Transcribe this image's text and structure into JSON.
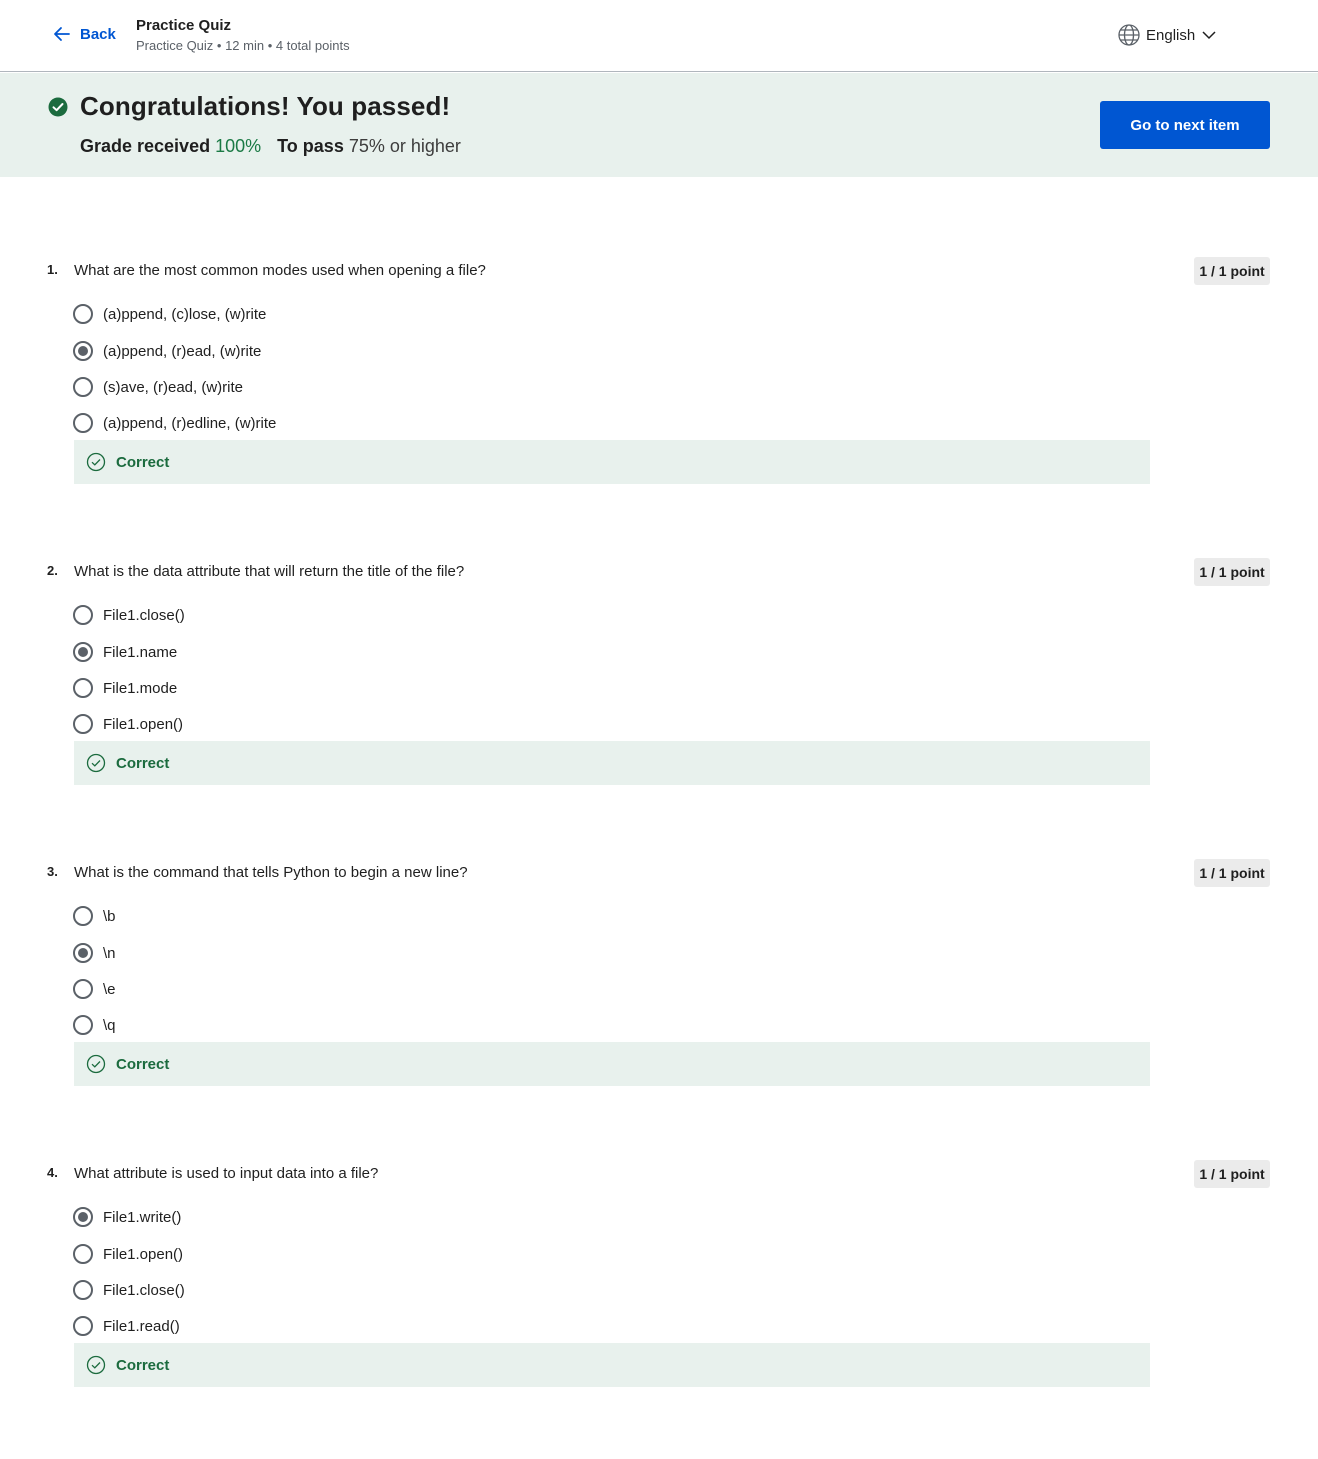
{
  "header": {
    "back_label": "Back",
    "title": "Practice Quiz",
    "subtitle": "Practice Quiz • 12 min • 4 total points",
    "language": "English"
  },
  "banner": {
    "heading": "Congratulations! You passed!",
    "grade_label": "Grade received",
    "grade_value": "100%",
    "pass_label": "To pass",
    "pass_value": "75% or higher",
    "next_button": "Go to next item"
  },
  "questions": [
    {
      "number": "1.",
      "text": "What are the most common modes used when opening a file?",
      "points": "1 / 1 point",
      "options": [
        "(a)ppend, (c)lose, (w)rite",
        "(a)ppend, (r)ead, (w)rite",
        "(s)ave, (r)ead, (w)rite",
        "(a)ppend, (r)edline, (w)rite"
      ],
      "selected": 1,
      "feedback": "Correct"
    },
    {
      "number": "2.",
      "text": "What is the data attribute that will return the title of the file?",
      "points": "1 / 1 point",
      "options": [
        "File1.close()",
        "File1.name",
        "File1.mode",
        "File1.open()"
      ],
      "selected": 1,
      "feedback": "Correct"
    },
    {
      "number": "3.",
      "text": "What is the command that tells Python to begin a new line?",
      "points": "1 / 1 point",
      "options": [
        "\\b",
        "\\n",
        "\\e",
        "\\q"
      ],
      "selected": 1,
      "feedback": "Correct"
    },
    {
      "number": "4.",
      "text": "What attribute is used to input data into a file?",
      "points": "1 / 1 point",
      "options": [
        "File1.write()",
        "File1.open()",
        "File1.close()",
        "File1.read()"
      ],
      "selected": 0,
      "feedback": "Correct"
    }
  ],
  "colors": {
    "accent": "#0056d2",
    "success": "#1b7a45",
    "banner_bg": "#e8f1ed"
  },
  "icons": {
    "back": "arrow-left-icon",
    "language": "globe-icon",
    "dropdown": "chevron-down-icon",
    "passed": "check-circle-filled-icon",
    "correct": "check-circle-outline-icon"
  }
}
